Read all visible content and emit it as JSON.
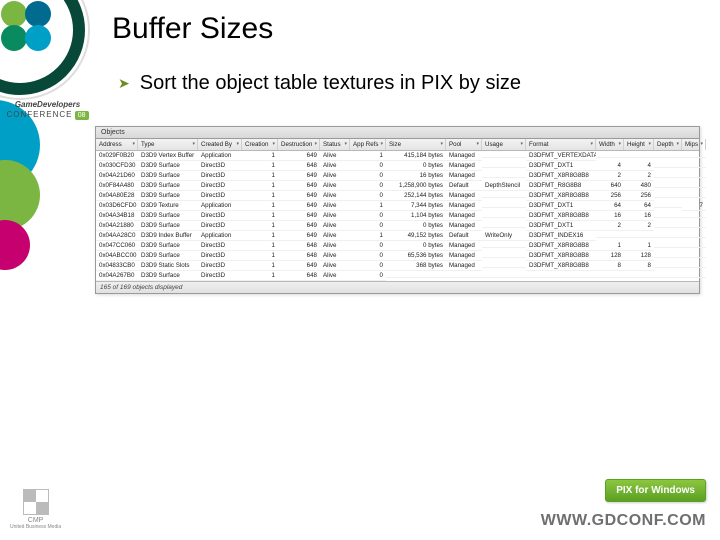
{
  "title": "Buffer Sizes",
  "bullet": "Sort the object table textures in PIX by size",
  "conference": {
    "label": "GameDevelopers",
    "sub": "CONFERENCE",
    "year": "08"
  },
  "pix": {
    "tab_label": "Objects",
    "headers": [
      "Address",
      "Type",
      "Created By",
      "Creation",
      "Destruction",
      "Status",
      "App Refs",
      "Size",
      "Pool",
      "Usage",
      "Format",
      "Width",
      "Height",
      "Depth",
      "Mips"
    ],
    "rows": [
      {
        "addr": "0x029F0B20",
        "type": "D3D9 Vertex Buffer",
        "creator": "Application",
        "creation": "1",
        "destruction": "649",
        "status": "Alive",
        "refs": "1",
        "size": "415,184 bytes",
        "pool": "Managed",
        "usage": "",
        "format": "D3DFMT_VERTEXDATA",
        "w": "",
        "h": "",
        "d": "",
        "m": ""
      },
      {
        "addr": "0x030CFD30",
        "type": "D3D9 Surface",
        "creator": "Direct3D",
        "creation": "1",
        "destruction": "648",
        "status": "Alive",
        "refs": "0",
        "size": "0 bytes",
        "pool": "Managed",
        "usage": "",
        "format": "D3DFMT_DXT1",
        "w": "4",
        "h": "4",
        "d": "",
        "m": ""
      },
      {
        "addr": "0x04A21D60",
        "type": "D3D9 Surface",
        "creator": "Direct3D",
        "creation": "1",
        "destruction": "649",
        "status": "Alive",
        "refs": "0",
        "size": "16 bytes",
        "pool": "Managed",
        "usage": "",
        "format": "D3DFMT_X8R8G8B8",
        "w": "2",
        "h": "2",
        "d": "",
        "m": ""
      },
      {
        "addr": "0x0F84A480",
        "type": "D3D9 Surface",
        "creator": "Direct3D",
        "creation": "1",
        "destruction": "649",
        "status": "Alive",
        "refs": "0",
        "size": "1,258,900 bytes",
        "pool": "Default",
        "usage": "DepthStencil",
        "format": "D3DFMT_R8G8B8",
        "w": "640",
        "h": "480",
        "d": "",
        "m": ""
      },
      {
        "addr": "0x04A80E28",
        "type": "D3D9 Surface",
        "creator": "Direct3D",
        "creation": "1",
        "destruction": "649",
        "status": "Alive",
        "refs": "0",
        "size": "252,144 bytes",
        "pool": "Managed",
        "usage": "",
        "format": "D3DFMT_X8R8G8B8",
        "w": "256",
        "h": "256",
        "d": "",
        "m": ""
      },
      {
        "addr": "0x03D6CFD0",
        "type": "D3D9 Texture",
        "creator": "Application",
        "creation": "1",
        "destruction": "649",
        "status": "Alive",
        "refs": "1",
        "size": "7,344 bytes",
        "pool": "Managed",
        "usage": "",
        "format": "D3DFMT_DXT1",
        "w": "64",
        "h": "64",
        "d": "",
        "m": "7"
      },
      {
        "addr": "0x04A34B18",
        "type": "D3D9 Surface",
        "creator": "Direct3D",
        "creation": "1",
        "destruction": "649",
        "status": "Alive",
        "refs": "0",
        "size": "1,104 bytes",
        "pool": "Managed",
        "usage": "",
        "format": "D3DFMT_X8R8G8B8",
        "w": "16",
        "h": "16",
        "d": "",
        "m": ""
      },
      {
        "addr": "0x04A21880",
        "type": "D3D9 Surface",
        "creator": "Direct3D",
        "creation": "1",
        "destruction": "649",
        "status": "Alive",
        "refs": "0",
        "size": "0 bytes",
        "pool": "Managed",
        "usage": "",
        "format": "D3DFMT_DXT1",
        "w": "2",
        "h": "2",
        "d": "",
        "m": ""
      },
      {
        "addr": "0x04AA28C0",
        "type": "D3D9 Index Buffer",
        "creator": "Application",
        "creation": "1",
        "destruction": "649",
        "status": "Alive",
        "refs": "1",
        "size": "49,152 bytes",
        "pool": "Default",
        "usage": "WriteOnly",
        "format": "D3DFMT_INDEX16",
        "w": "",
        "h": "",
        "d": "",
        "m": ""
      },
      {
        "addr": "0x047CC060",
        "type": "D3D9 Surface",
        "creator": "Direct3D",
        "creation": "1",
        "destruction": "648",
        "status": "Alive",
        "refs": "0",
        "size": "0 bytes",
        "pool": "Managed",
        "usage": "",
        "format": "D3DFMT_X8R8G8B8",
        "w": "1",
        "h": "1",
        "d": "",
        "m": ""
      },
      {
        "addr": "0x04ABCC00",
        "type": "D3D9 Surface",
        "creator": "Direct3D",
        "creation": "1",
        "destruction": "648",
        "status": "Alive",
        "refs": "0",
        "size": "65,536 bytes",
        "pool": "Managed",
        "usage": "",
        "format": "D3DFMT_X8R8G8B8",
        "w": "128",
        "h": "128",
        "d": "",
        "m": ""
      },
      {
        "addr": "0x04833CB0",
        "type": "D3D9 Static Slots",
        "creator": "Direct3D",
        "creation": "1",
        "destruction": "649",
        "status": "Alive",
        "refs": "0",
        "size": "368 bytes",
        "pool": "Managed",
        "usage": "",
        "format": "D3DFMT_X8R8G8B8",
        "w": "8",
        "h": "8",
        "d": "",
        "m": ""
      },
      {
        "addr": "0x04A267B0",
        "type": "D3D9 Surface",
        "creator": "Direct3D",
        "creation": "1",
        "destruction": "648",
        "status": "Alive",
        "refs": "0",
        "size": "",
        "pool": "",
        "usage": "",
        "format": "",
        "w": "",
        "h": "",
        "d": "",
        "m": ""
      }
    ],
    "status": "165 of 169 objects displayed"
  },
  "pix_badge": "PIX for Windows",
  "footer_site": "WWW.GDCONF.COM",
  "cmp": {
    "name": "CMP",
    "sub": "United Business Media"
  }
}
